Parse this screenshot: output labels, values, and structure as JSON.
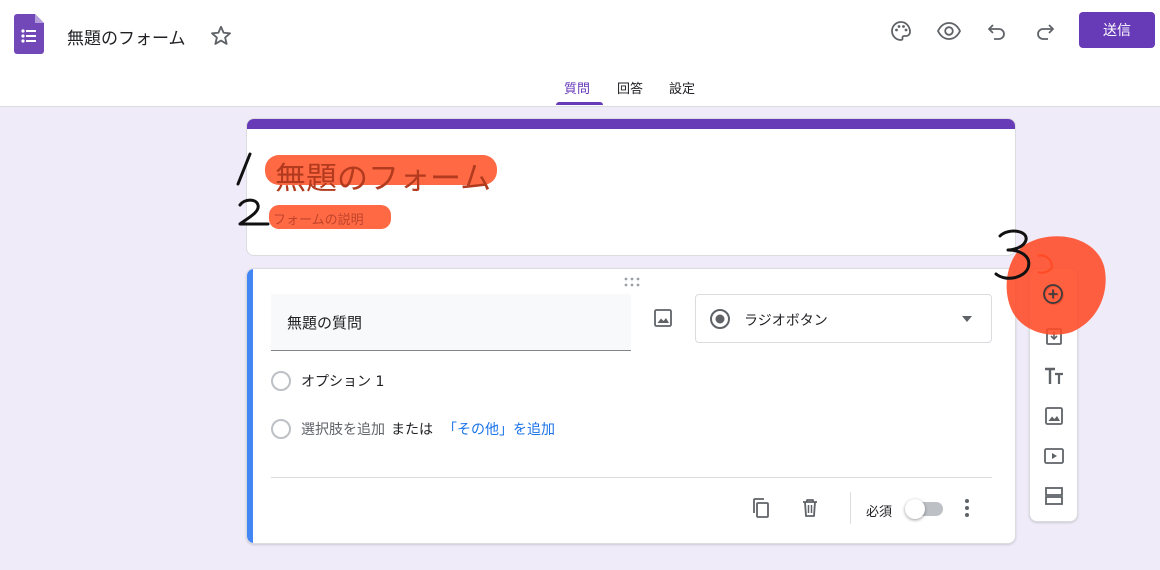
{
  "header": {
    "doc_title": "無題のフォーム",
    "send_label": "送信"
  },
  "tabs": [
    {
      "label": "質問",
      "active": true
    },
    {
      "label": "回答",
      "active": false
    },
    {
      "label": "設定",
      "active": false
    }
  ],
  "form": {
    "title": "無題のフォーム",
    "description_placeholder": "フォームの説明"
  },
  "question": {
    "title": "無題の質問",
    "type": "ラジオボタン",
    "options": [
      "オプション 1"
    ],
    "add_option": "選択肢を追加",
    "or_text": "または",
    "add_other": "「その他」を追加",
    "required_label": "必須",
    "required": false
  },
  "annotations": [
    "1",
    "2",
    "3"
  ],
  "colors": {
    "accent": "#673ab7",
    "background": "#f0ebf8",
    "active_question": "#4285f4",
    "annotation": "#ff4a26"
  },
  "icons": {
    "toolbar": [
      "add-question-icon",
      "import-questions-icon",
      "add-title-icon",
      "add-image-icon",
      "add-video-icon",
      "add-section-icon"
    ],
    "header": [
      "palette-icon",
      "preview-icon",
      "undo-icon",
      "redo-icon"
    ],
    "footer": [
      "duplicate-icon",
      "delete-icon",
      "more-vert-icon"
    ]
  }
}
